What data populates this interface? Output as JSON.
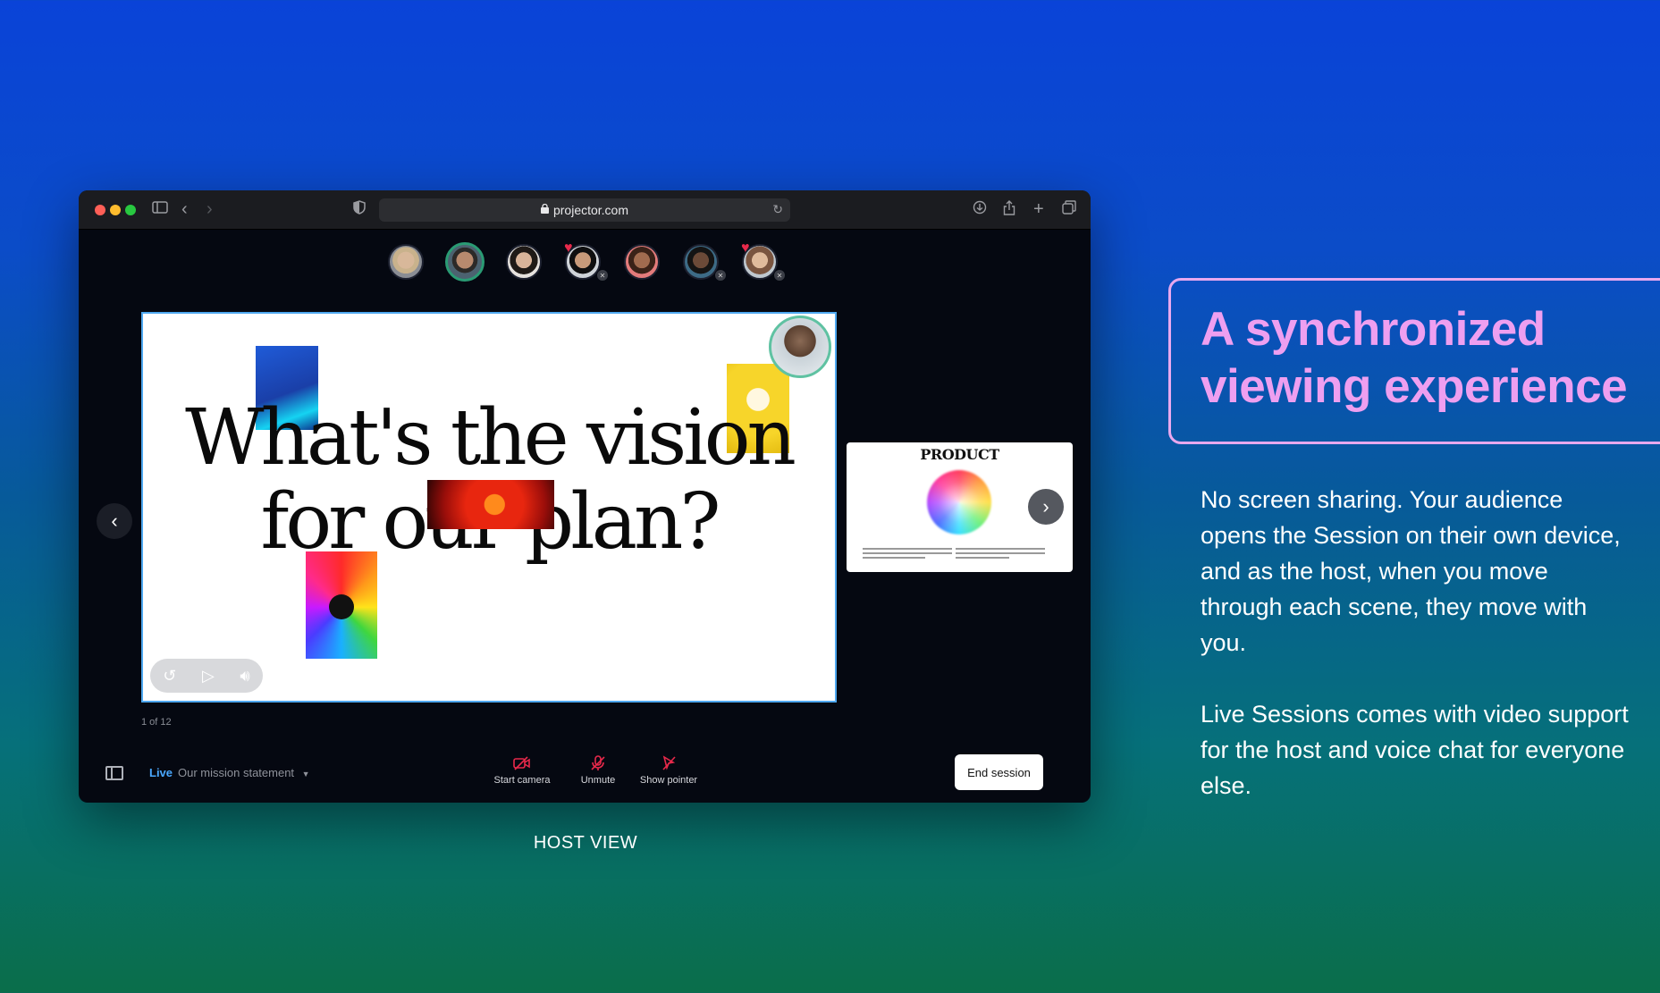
{
  "browser": {
    "url": "projector.com",
    "traffic_lights": [
      "#ff5f57",
      "#febc2e",
      "#28c840"
    ]
  },
  "participants": [
    {
      "name": "participant-1",
      "skin": "#d8b89a",
      "hair": "#c9b28c"
    },
    {
      "name": "participant-2",
      "skin": "#b88a6e",
      "hair": "#2c2a28",
      "active": true
    },
    {
      "name": "participant-3",
      "skin": "#d9b49a",
      "hair": "#1f1a17"
    },
    {
      "name": "participant-4",
      "skin": "#c89a7a",
      "hair": "#0f0f10",
      "heart": true,
      "mic": true
    },
    {
      "name": "participant-5",
      "skin": "#a06b4f",
      "hair": "#3a2218"
    },
    {
      "name": "participant-6",
      "skin": "#6b4a38",
      "hair": "#141414",
      "mic": true
    },
    {
      "name": "participant-7",
      "skin": "#e0bb9c",
      "hair": "#7a5540",
      "heart": true,
      "mic": true
    }
  ],
  "slide": {
    "title_line1": "What's the vision",
    "title_line2": "for our plan?"
  },
  "next_slide": {
    "title": "PRODUCT"
  },
  "slide_counter": "1 of 12",
  "bottom_bar": {
    "live_label": "Live",
    "session_name": "Our mission statement",
    "start_camera": "Start camera",
    "unmute": "Unmute",
    "show_pointer": "Show pointer",
    "end_session": "End session"
  },
  "caption": "HOST VIEW",
  "marketing": {
    "headline_line1": "A synchronized",
    "headline_line2": "viewing experience",
    "paragraph1": "No screen sharing. Your audience opens the Session on their own device, and as the host, when you move through each scene, they move with you.",
    "paragraph2": "Live Sessions comes with video support for the host and voice chat for everyone else."
  },
  "colors": {
    "accent_live": "#4aa8ff",
    "headline": "#ee9ff0",
    "recording_red": "#e8294b"
  }
}
